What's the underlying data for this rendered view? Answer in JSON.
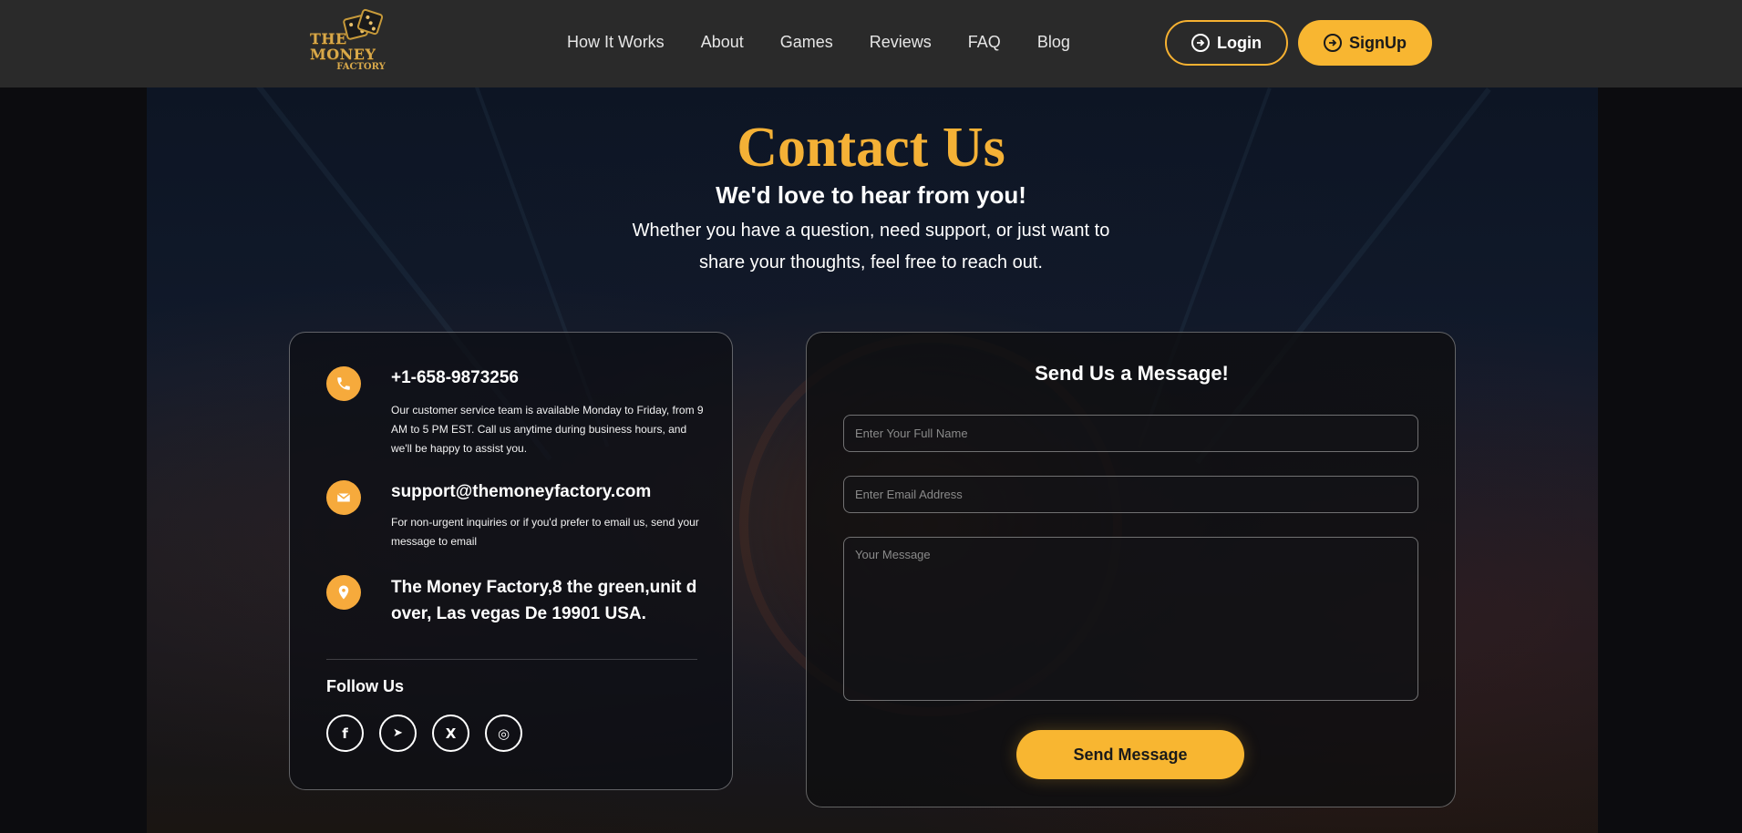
{
  "header": {
    "logo_line1": "THE MONEY",
    "logo_line2": "FACTORY",
    "nav": [
      "How It Works",
      "About",
      "Games",
      "Reviews",
      "FAQ",
      "Blog"
    ],
    "login_label": "Login",
    "signup_label": "SignUp"
  },
  "hero": {
    "title": "Contact Us",
    "subtitle": "We'd love to hear from you!",
    "intro": "Whether you have a question, need support, or just want to share your thoughts, feel free to reach out."
  },
  "contact": {
    "phone": "+1-658-9873256",
    "phone_desc": "Our customer service team is available Monday to Friday, from 9 AM to 5 PM EST. Call us anytime during business hours, and we'll be happy to assist you.",
    "email": "support@themoneyfactory.com",
    "email_desc": "For non-urgent inquiries or if you'd prefer to email us, send your message to email",
    "address": "The Money Factory,8 the green,unit d over, Las vegas De 19901 USA.",
    "follow_label": "Follow Us",
    "social": [
      {
        "icon": "facebook-icon",
        "glyph": "f"
      },
      {
        "icon": "telegram-icon",
        "glyph": "➤"
      },
      {
        "icon": "x-icon",
        "glyph": "X"
      },
      {
        "icon": "instagram-icon",
        "glyph": "◎"
      }
    ]
  },
  "form": {
    "title": "Send Us a Message!",
    "name_placeholder": "Enter Your Full Name",
    "email_placeholder": "Enter Email Address",
    "message_placeholder": "Your Message",
    "send_label": "Send Message"
  },
  "colors": {
    "accent": "#f8b631",
    "header_bg": "#2a2a2a",
    "title": "#f4b136"
  }
}
